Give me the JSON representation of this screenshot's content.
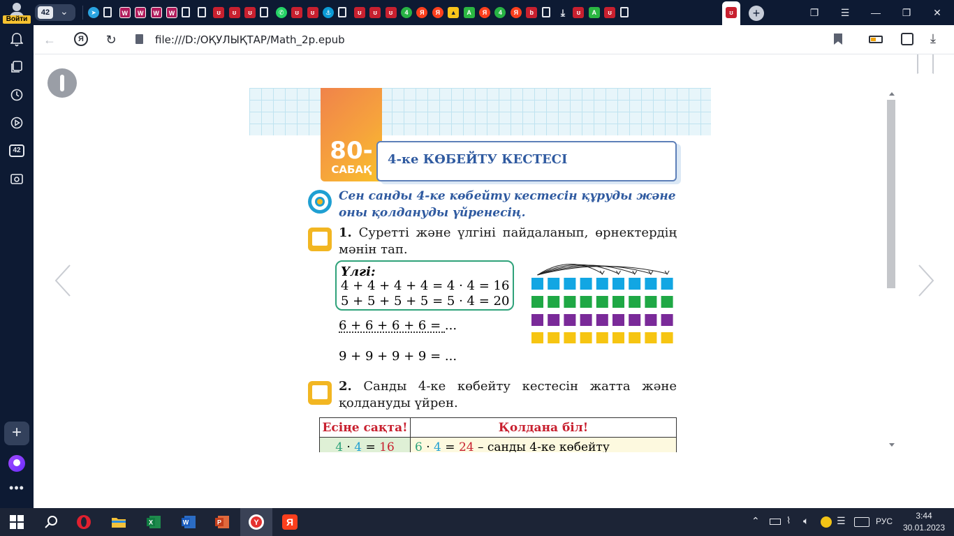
{
  "sidebar": {
    "profile_label": "Войти",
    "tabs_badge": "42"
  },
  "tabbar": {
    "tab_count": "42",
    "favicons": [
      "telegram",
      "doc",
      "pink",
      "pink",
      "pink",
      "pink",
      "doc",
      "doc",
      "red",
      "red",
      "red",
      "doc",
      "whatsapp",
      "red",
      "red",
      "shipwheel",
      "doc",
      "red",
      "red",
      "red",
      "green",
      "yandex",
      "yandex",
      "yellow",
      "green-tri",
      "yandex",
      "green",
      "yandex",
      "red-b",
      "doc",
      "download",
      "red",
      "green-tri",
      "red",
      "doc"
    ]
  },
  "addressbar": {
    "url": "file:///D:/ОҚУЛЫҚТАР/Math_2p.epub"
  },
  "book": {
    "lesson_number": "80-",
    "lesson_word": "САБАҚ",
    "title": "4-ке КӨБЕЙТУ КЕСТЕСІ",
    "goal": "Сен санды 4-ке көбейту кестесін құруды және оны қолдануды үйренесің.",
    "task1_number": "1.",
    "task1_text": "Суретті және үлгіні пайдаланып, өрнектердің мәнін тап.",
    "sample_title": "Үлгі:",
    "sample_line1": "4 + 4 + 4 + 4 = 4 · 4 = 16",
    "sample_line2": "5 + 5 + 5 + 5 = 5 · 4 = 20",
    "expr1": "6 + 6 + 6 + 6 = ...",
    "expr2": "9 + 9 + 9 + 9 = ...",
    "task2_number": "2.",
    "task2_text": "Санды 4-ке көбейту кестесін жатта және қолдануды үйрен.",
    "table_head_left": "Есіңе сақта!",
    "table_head_right": "Қолдана біл!",
    "row1_left_a": "4",
    "row1_left_b": "4",
    "row1_left_c": "16",
    "row1_right_a": "6",
    "row1_right_b": "4",
    "row1_right_c": "24",
    "row1_right_text": "– санды 4-ке көбейту",
    "block_colors": [
      "#12a6e3",
      "#1fa845",
      "#7a2a99",
      "#f6c512"
    ],
    "blocks_per_row": 9
  },
  "taskbar": {
    "lang": "РУС",
    "time": "3:44",
    "date": "30.01.2023"
  }
}
